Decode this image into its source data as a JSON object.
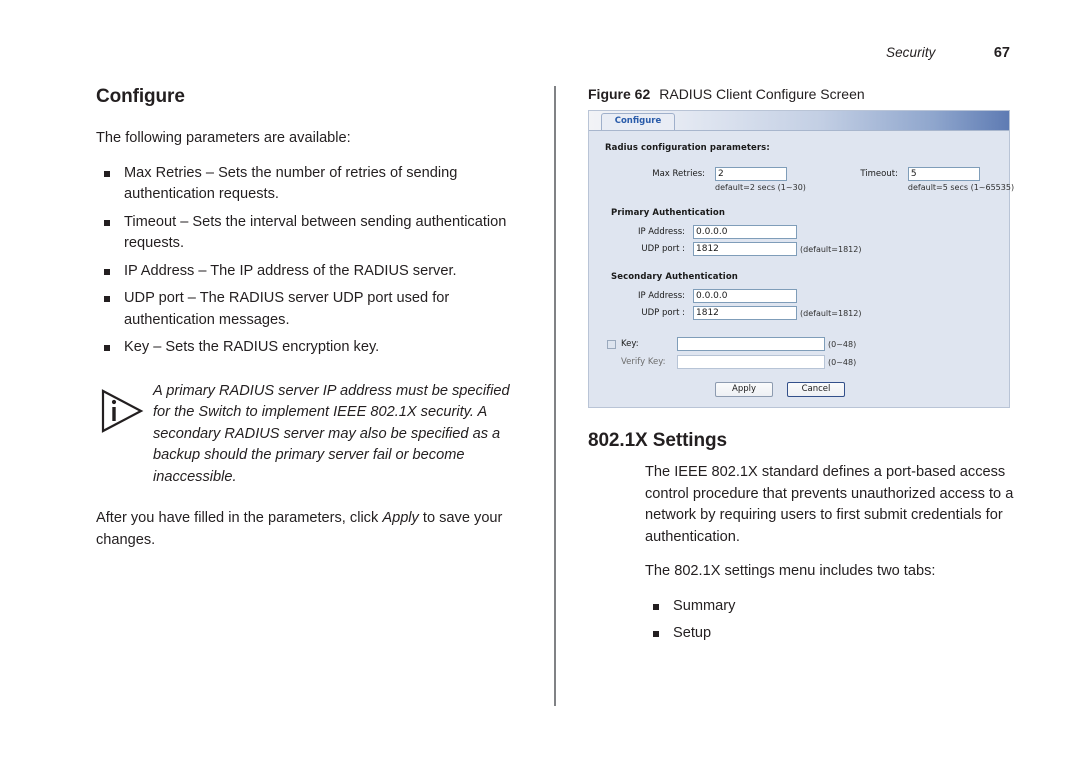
{
  "header": {
    "chapter": "Security",
    "page_number": "67"
  },
  "left_column": {
    "heading": "Configure",
    "intro": "The following parameters are available:",
    "bullets": [
      "Max Retries – Sets the number of retries of sending authentication requests.",
      "Timeout – Sets the interval between sending authentication requests.",
      "IP Address – The IP address of the RADIUS server.",
      "UDP port – The RADIUS server UDP port used for authentication messages.",
      "Key – Sets the RADIUS encryption key."
    ],
    "note": {
      "icon": "info-triangle-icon",
      "text": "A primary RADIUS server IP address must be specified for the Switch to implement IEEE 802.1X security. A secondary RADIUS server may also be specified as a backup should the primary server fail or become inaccessible."
    },
    "closing_before": "After you have filled in the parameters, click ",
    "closing_emphasis": "Apply",
    "closing_after": " to save your changes."
  },
  "figure": {
    "number": "Figure 62",
    "title": "RADIUS Client Configure Screen",
    "screen": {
      "tab_label": "Configure",
      "group_title": "Radius configuration parameters:",
      "max_retries": {
        "label": "Max Retries:",
        "value": "2",
        "hint": "default=2 secs (1~30)"
      },
      "timeout": {
        "label": "Timeout:",
        "value": "5",
        "hint": "default=5 secs (1~65535)"
      },
      "primary": {
        "title": "Primary Authentication",
        "ip_label": "IP Address:",
        "ip_value": "0.0.0.0",
        "udp_label": "UDP port :",
        "udp_value": "1812",
        "udp_hint": "(default=1812)"
      },
      "secondary": {
        "title": "Secondary Authentication",
        "ip_label": "IP Address:",
        "ip_value": "0.0.0.0",
        "udp_label": "UDP port :",
        "udp_value": "1812",
        "udp_hint": "(default=1812)"
      },
      "key": {
        "label": "Key:",
        "value": "",
        "hint": "(0~48)",
        "verify_label": "Verify Key:",
        "verify_value": "",
        "verify_hint": "(0~48)"
      },
      "apply_button": "Apply",
      "cancel_button": "Cancel"
    }
  },
  "right_column": {
    "heading": "802.1X Settings",
    "paragraph1": "The IEEE 802.1X standard defines a port-based access control procedure that prevents unauthorized access to a network by requiring users to first submit credentials for authentication.",
    "paragraph2": "The 802.1X settings menu includes two tabs:",
    "bullets": [
      "Summary",
      "Setup"
    ]
  },
  "colors": {
    "tab_text": "#2a5caa",
    "panel_bg": "#dfe5f0",
    "text": "#231f20"
  }
}
